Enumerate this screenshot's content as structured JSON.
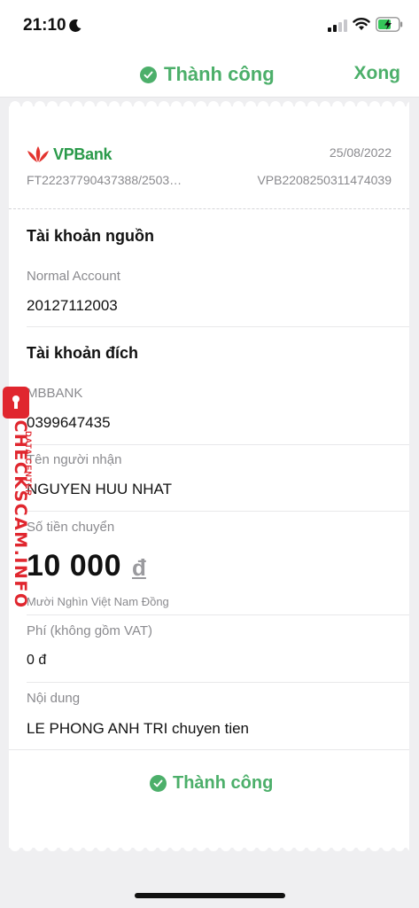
{
  "status_bar": {
    "time": "21:10"
  },
  "header": {
    "title": "Thành công",
    "done_label": "Xong"
  },
  "receipt": {
    "bank_name": "VPBank",
    "date": "25/08/2022",
    "ref_left": "FT22237790437388/2503…",
    "ref_right": "VPB2208250311474039",
    "source_section": "Tài khoản nguồn",
    "source_type": "Normal Account",
    "source_number": "20127112003",
    "dest_section": "Tài khoản đích",
    "dest_bank": "MBBANK",
    "dest_number": "0399647435",
    "recipient_label": "Tên người nhận",
    "recipient_name": "NGUYEN HUU NHAT",
    "amount_label": "Số tiền chuyển",
    "amount": "10 000",
    "currency": "đ",
    "amount_words": "Mười Nghìn Việt Nam Đồng",
    "fee_label": "Phí (không gồm VAT)",
    "fee_value": "0 đ",
    "content_label": "Nội dung",
    "content_value": "LE PHONG ANH TRI chuyen tien",
    "footer_status": "Thành công"
  },
  "watermark": {
    "main": "CHECKSCAM.INFO",
    "sub": "DATA CENTER"
  },
  "colors": {
    "success": "#4caf6a",
    "brand_green": "#2a9a4a",
    "watermark_red": "#e0262e"
  }
}
